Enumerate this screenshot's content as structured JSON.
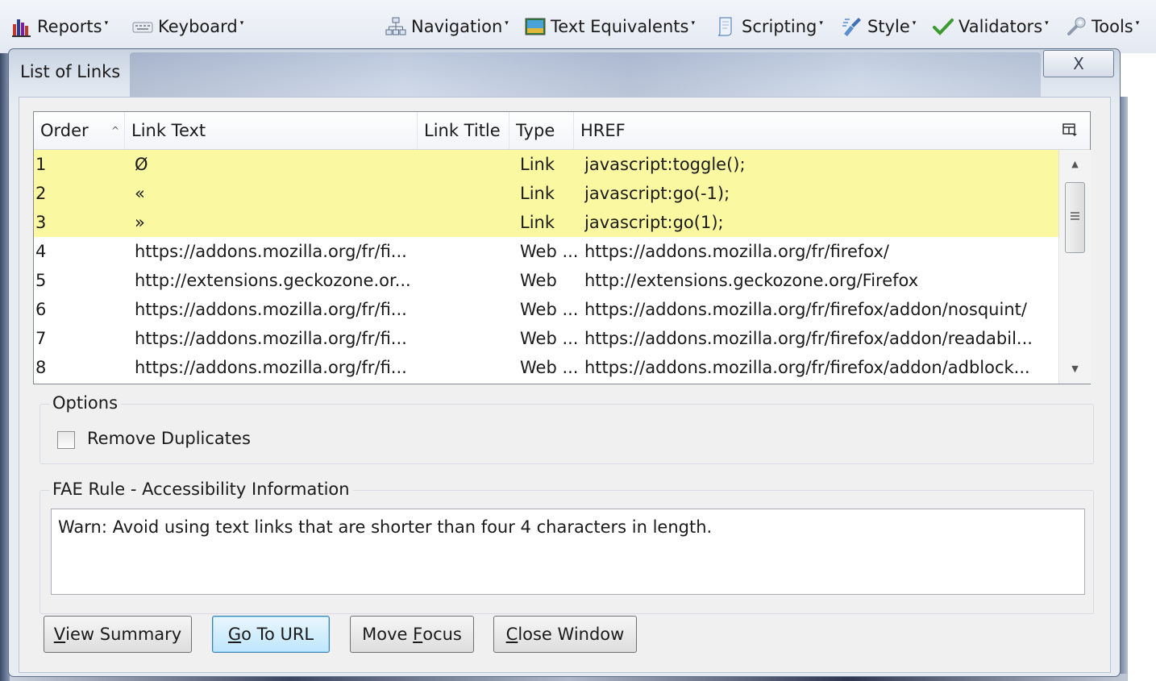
{
  "toolbar": {
    "items": [
      {
        "label": "Reports",
        "icon": "bar-chart-icon"
      },
      {
        "label": "Keyboard",
        "icon": "keyboard-icon"
      },
      {
        "label": "Navigation",
        "icon": "sitemap-icon"
      },
      {
        "label": "Text Equivalents",
        "icon": "image-icon"
      },
      {
        "label": "Scripting",
        "icon": "script-page-icon"
      },
      {
        "label": "Style",
        "icon": "style-brush-icon"
      },
      {
        "label": "Validators",
        "icon": "checkmark-icon"
      },
      {
        "label": "Tools",
        "icon": "wrench-icon"
      }
    ]
  },
  "dialog": {
    "title": "List of Links",
    "close_glyph": "X",
    "table": {
      "columns": [
        "Order",
        "Link Text",
        "Link Title",
        "Type",
        "HREF"
      ],
      "sort_indicator": "^",
      "rows": [
        {
          "order": "1",
          "text": "Ø",
          "title": "",
          "type": "Link",
          "href": "javascript:toggle();",
          "highlight": true
        },
        {
          "order": "2",
          "text": "«",
          "title": "",
          "type": "Link",
          "href": "javascript:go(-1);",
          "highlight": true
        },
        {
          "order": "3",
          "text": "»",
          "title": "",
          "type": "Link",
          "href": "javascript:go(1);",
          "highlight": true
        },
        {
          "order": "4",
          "text": "https://addons.mozilla.org/fr/fi...",
          "title": "",
          "type": "Web ...",
          "href": "https://addons.mozilla.org/fr/firefox/",
          "highlight": false
        },
        {
          "order": "5",
          "text": "http://extensions.geckozone.or...",
          "title": "",
          "type": "Web",
          "href": "http://extensions.geckozone.org/Firefox",
          "highlight": false
        },
        {
          "order": "6",
          "text": "https://addons.mozilla.org/fr/fi...",
          "title": "",
          "type": "Web ...",
          "href": "https://addons.mozilla.org/fr/firefox/addon/nosquint/",
          "highlight": false
        },
        {
          "order": "7",
          "text": "https://addons.mozilla.org/fr/fi...",
          "title": "",
          "type": "Web ...",
          "href": "https://addons.mozilla.org/fr/firefox/addon/readabil...",
          "highlight": false
        },
        {
          "order": "8",
          "text": "https://addons.mozilla.org/fr/fi...",
          "title": "",
          "type": "Web ...",
          "href": "https://addons.mozilla.org/fr/firefox/addon/adblock...",
          "highlight": false
        }
      ],
      "highlight_color": "#fbf8a2"
    },
    "options": {
      "label": "Options",
      "remove_duplicates_label": "Remove Duplicates",
      "remove_duplicates_checked": false
    },
    "fae": {
      "label": "FAE Rule - Accessibility Information",
      "message": "Warn: Avoid using text links that are shorter than four 4 characters in length."
    },
    "buttons": {
      "view_summary": {
        "accel": "V",
        "rest": "iew Summary"
      },
      "go_to_url": {
        "accel": "G",
        "rest": "o To URL"
      },
      "move_focus": {
        "pre": "Move ",
        "accel": "F",
        "rest": "ocus"
      },
      "close_window": {
        "accel": "C",
        "rest": "lose Window"
      }
    }
  }
}
